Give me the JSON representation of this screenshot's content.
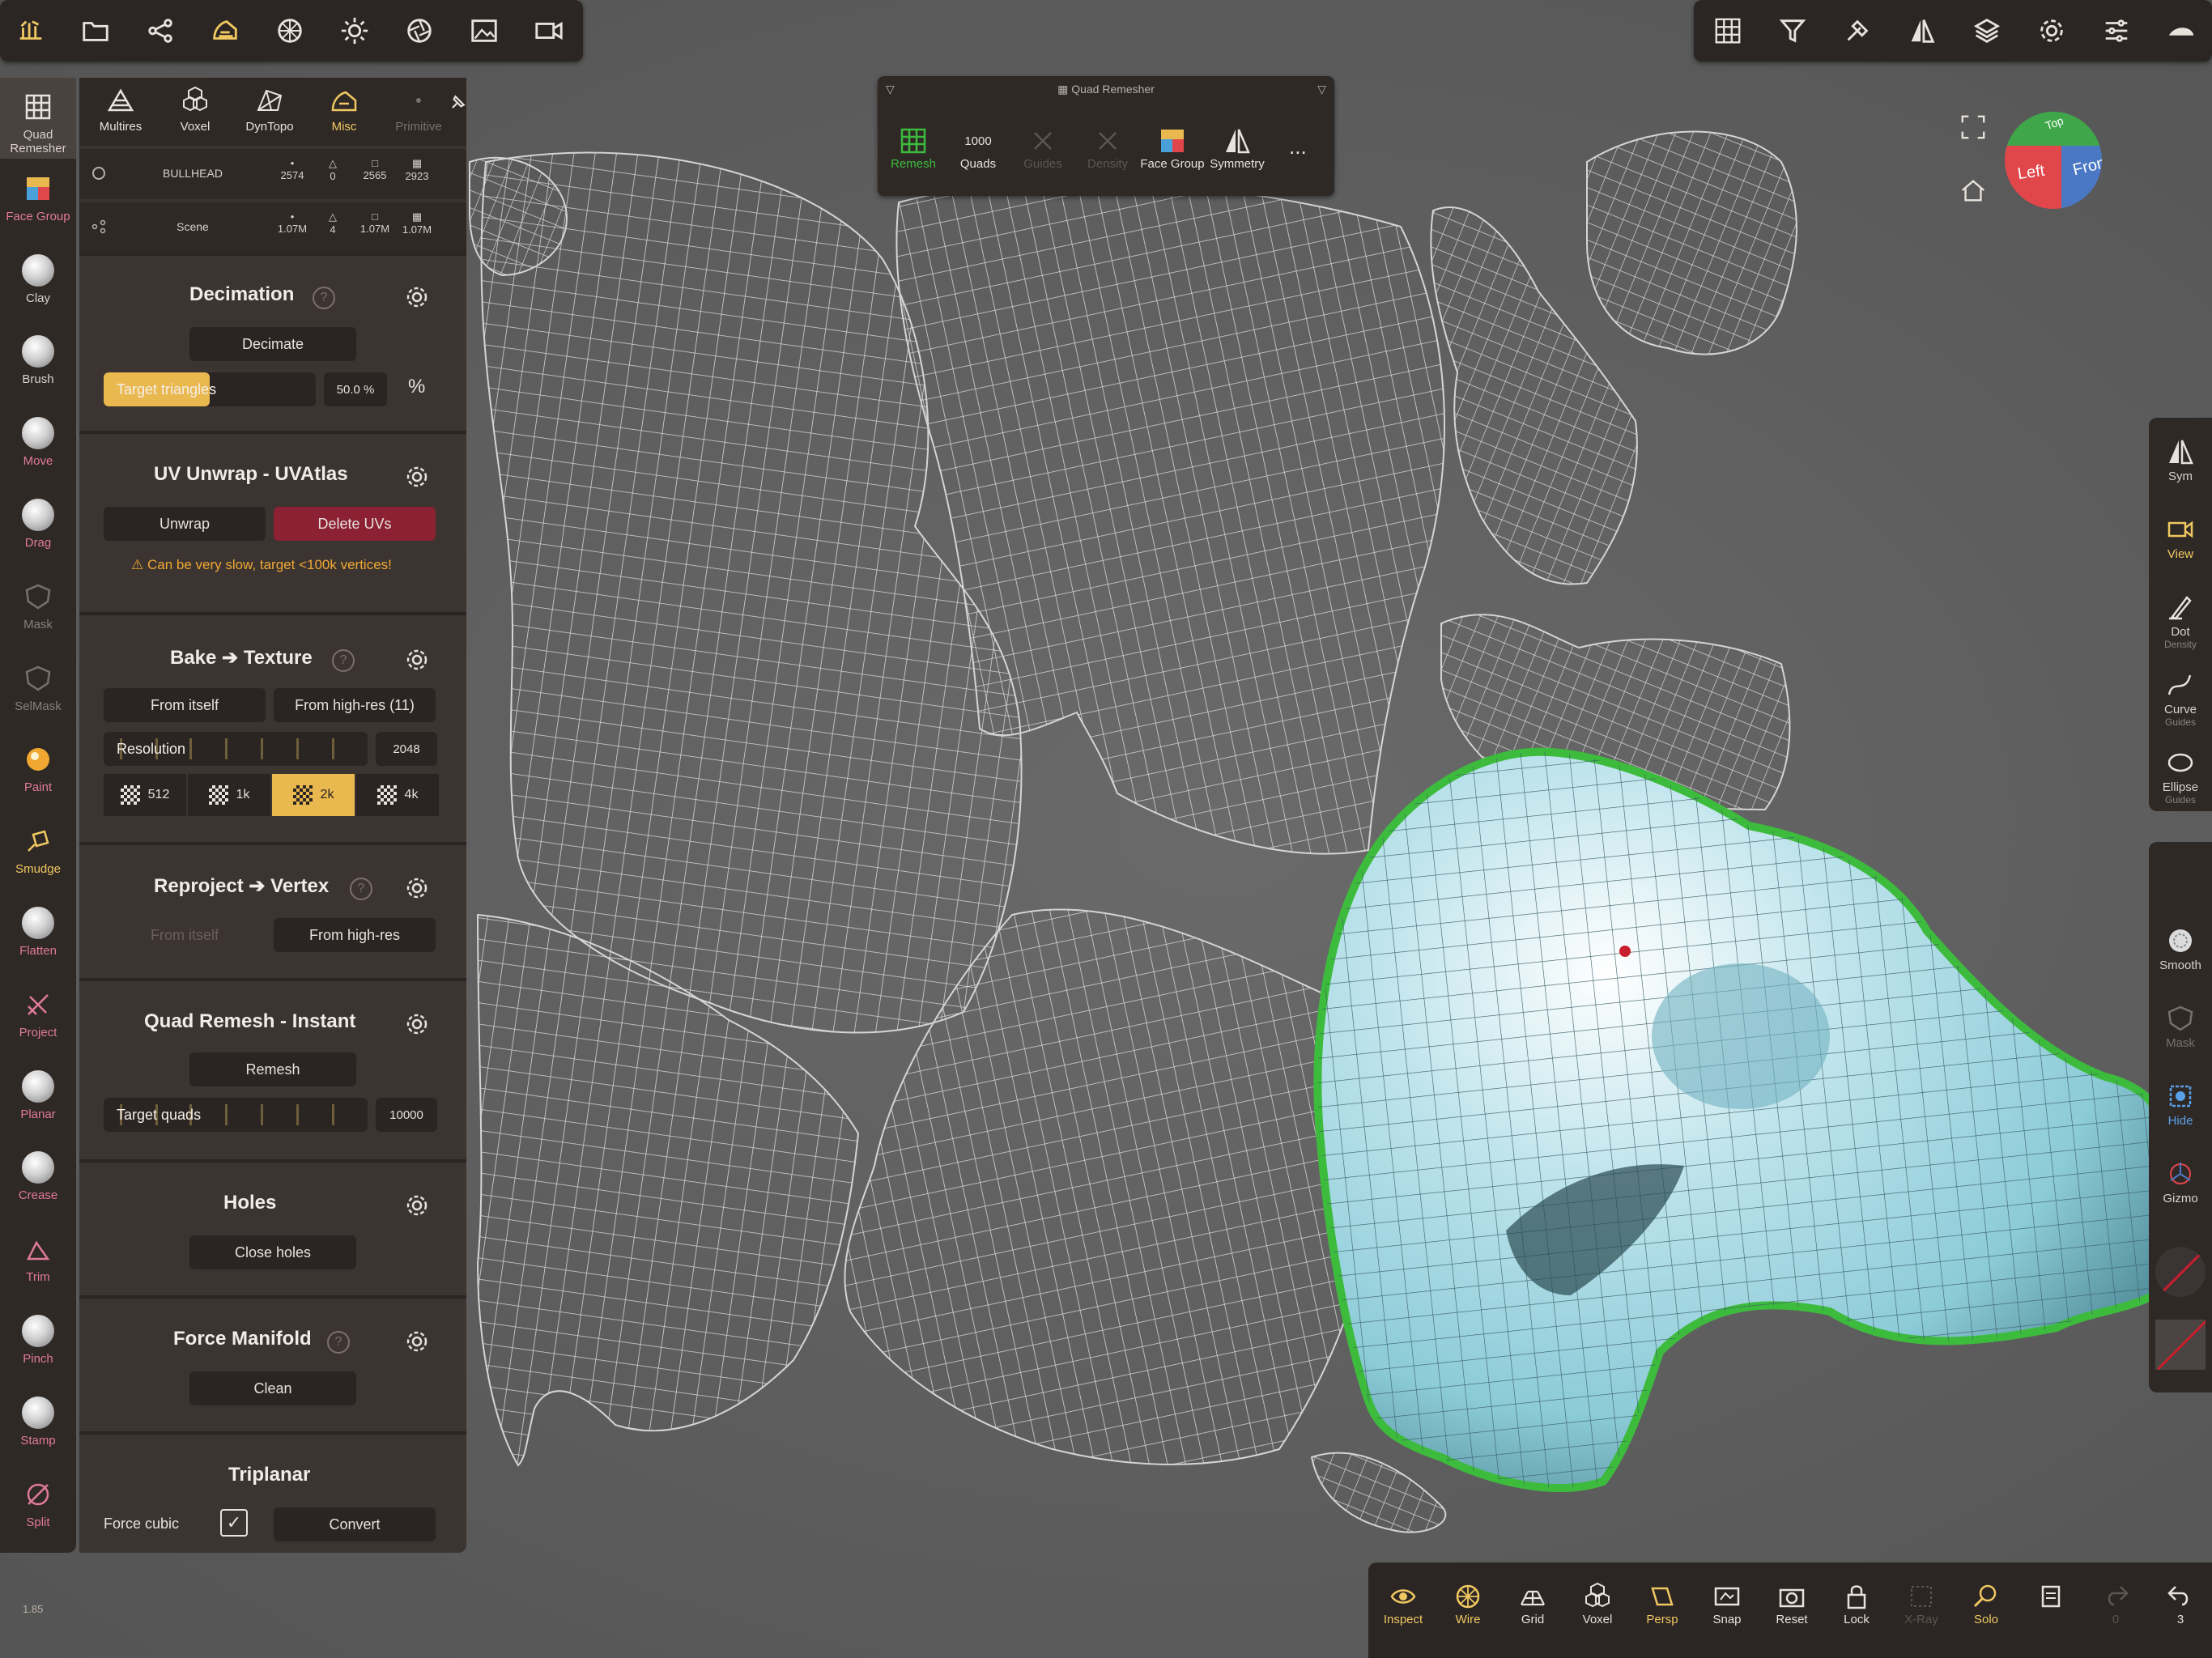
{
  "version": "1.85",
  "colors": {
    "accent": "#e9b84f",
    "danger": "#8b2133",
    "selection_outline": "#3dbb3d",
    "mesh": "#cfcfcf",
    "warning": "#f0a832"
  },
  "top_toolbar_left": {
    "icons": [
      "scene-icon",
      "folder-icon",
      "share-icon",
      "misc-icon",
      "material-icon",
      "light-icon",
      "camera-aperture-icon",
      "image-icon",
      "video-icon"
    ]
  },
  "top_toolbar_right": {
    "icons": [
      "grid-icon",
      "filter-icon",
      "tools-icon",
      "symmetry-icon",
      "layers-icon",
      "settings-icon",
      "sliders-icon",
      "nomad-logo-icon"
    ]
  },
  "left_tools": [
    {
      "label": "Quad Remesher",
      "icon": "quad-grid-icon",
      "style": "selected"
    },
    {
      "label": "Face Group",
      "icon": "face-group-icon",
      "style": "pink"
    },
    {
      "label": "Clay",
      "icon": "sphere-icon",
      "style": "normal"
    },
    {
      "label": "Brush",
      "icon": "sphere-icon",
      "style": "normal"
    },
    {
      "label": "Move",
      "icon": "sphere-icon",
      "style": "pink"
    },
    {
      "label": "Drag",
      "icon": "sphere-icon",
      "style": "pink"
    },
    {
      "label": "Mask",
      "icon": "mask-icon",
      "style": "dim"
    },
    {
      "label": "SelMask",
      "icon": "mask-icon",
      "style": "dim"
    },
    {
      "label": "Paint",
      "icon": "paint-icon",
      "style": "pink"
    },
    {
      "label": "Smudge",
      "icon": "smudge-icon",
      "style": "yellow"
    },
    {
      "label": "Flatten",
      "icon": "sphere-icon",
      "style": "pink"
    },
    {
      "label": "Project",
      "icon": "project-icon",
      "style": "pink"
    },
    {
      "label": "Planar",
      "icon": "sphere-icon",
      "style": "pink"
    },
    {
      "label": "Crease",
      "icon": "sphere-icon",
      "style": "pink"
    },
    {
      "label": "Trim",
      "icon": "trim-icon",
      "style": "pink"
    },
    {
      "label": "Pinch",
      "icon": "sphere-icon",
      "style": "pink"
    },
    {
      "label": "Stamp",
      "icon": "sphere-icon",
      "style": "pink"
    },
    {
      "label": "Split",
      "icon": "split-icon",
      "style": "pink"
    }
  ],
  "panel": {
    "tabs": [
      {
        "label": "Multires",
        "icon": "multires-icon",
        "state": "normal"
      },
      {
        "label": "Voxel",
        "icon": "voxel-icon",
        "state": "normal"
      },
      {
        "label": "DynTopo",
        "icon": "dyntopo-icon",
        "state": "normal"
      },
      {
        "label": "Misc",
        "icon": "misc-icon",
        "state": "active"
      },
      {
        "label": "Primitive",
        "icon": "primitive-icon",
        "state": "dim"
      }
    ],
    "object_info": {
      "name": "BULLHEAD",
      "vertices": "2574",
      "triangles": "0",
      "quads": "2565",
      "uvs": "2923"
    },
    "scene_info": {
      "name": "Scene",
      "vertices": "1.07M",
      "triangles": "4",
      "quads": "1.07M",
      "uvs": "1.07M"
    },
    "decimation": {
      "title": "Decimation",
      "button": "Decimate",
      "slider_label": "Target triangles",
      "slider_fraction": 0.5,
      "value": "50.0 %"
    },
    "uv_unwrap": {
      "title": "UV Unwrap - UVAtlas",
      "unwrap": "Unwrap",
      "delete": "Delete UVs",
      "warning": "Can be very slow, target <100k vertices!"
    },
    "bake": {
      "title": "Bake ➔ Texture",
      "from_itself": "From itself",
      "from_highres": "From high-res (11)",
      "resolution_label": "Resolution",
      "resolution_value": "2048",
      "options": [
        "512",
        "1k",
        "2k",
        "4k"
      ],
      "selected": "2k"
    },
    "reproject": {
      "title": "Reproject ➔ Vertex",
      "from_itself": "From itself",
      "from_highres": "From high-res"
    },
    "quad_remesh": {
      "title": "Quad Remesh - Instant",
      "button": "Remesh",
      "slider_label": "Target quads",
      "value": "10000"
    },
    "holes": {
      "title": "Holes",
      "button": "Close holes"
    },
    "force_manifold": {
      "title": "Force Manifold",
      "button": "Clean"
    },
    "triplanar": {
      "title": "Triplanar",
      "force_label": "Force cubic",
      "force_checked": true,
      "convert": "Convert"
    }
  },
  "quad_remesher": {
    "title": "Quad Remesher",
    "items": [
      {
        "label": "Remesh",
        "icon": "quad-grid-icon",
        "state": "green"
      },
      {
        "label": "Quads",
        "value": "1000",
        "state": "normal"
      },
      {
        "label": "Guides",
        "icon": "x-icon",
        "state": "dim"
      },
      {
        "label": "Density",
        "icon": "x-icon",
        "state": "dim"
      },
      {
        "label": "Face Group",
        "icon": "face-group-icon",
        "state": "normal"
      },
      {
        "label": "Symmetry",
        "icon": "symmetry-icon",
        "state": "normal"
      }
    ],
    "more": "..."
  },
  "nav_cube": {
    "left": "Left",
    "front": "Front",
    "top": "Top"
  },
  "right_tools_top": [
    {
      "label": "Sym",
      "sub": "",
      "icon": "symmetry-icon",
      "style": "normal"
    },
    {
      "label": "View",
      "sub": "",
      "icon": "camera-icon",
      "style": "yellow"
    },
    {
      "label": "Dot",
      "sub": "Density",
      "icon": "pen-icon",
      "style": "normal"
    },
    {
      "label": "Curve",
      "sub": "Guides",
      "icon": "curve-icon",
      "style": "normal"
    },
    {
      "label": "Ellipse",
      "sub": "Guides",
      "icon": "ellipse-icon",
      "style": "normal"
    }
  ],
  "right_tools_bottom": [
    {
      "label": "Smooth",
      "icon": "smooth-icon",
      "style": "normal"
    },
    {
      "label": "Mask",
      "icon": "mask-icon",
      "style": "dim"
    },
    {
      "label": "Hide",
      "icon": "hide-icon",
      "style": "blue"
    },
    {
      "label": "Gizmo",
      "icon": "gizmo-icon",
      "style": "normal"
    }
  ],
  "bottom_bar": [
    {
      "label": "Inspect",
      "icon": "eye-icon",
      "style": "yellow"
    },
    {
      "label": "Wire",
      "icon": "wire-icon",
      "style": "yellow"
    },
    {
      "label": "Grid",
      "icon": "grid-icon",
      "style": "normal"
    },
    {
      "label": "Voxel",
      "icon": "voxel-icon",
      "style": "normal"
    },
    {
      "label": "Persp",
      "icon": "persp-icon",
      "style": "yellow"
    },
    {
      "label": "Snap",
      "icon": "snap-icon",
      "style": "normal"
    },
    {
      "label": "Reset",
      "icon": "camera-reset-icon",
      "style": "normal"
    },
    {
      "label": "Lock",
      "icon": "lock-icon",
      "style": "normal"
    },
    {
      "label": "X-Ray",
      "icon": "xray-icon",
      "style": "dim"
    },
    {
      "label": "Solo",
      "icon": "search-icon",
      "style": "yellow"
    },
    {
      "label": "",
      "icon": "history-icon",
      "style": "normal"
    },
    {
      "label": "0",
      "icon": "redo-icon",
      "style": "dim"
    },
    {
      "label": "3",
      "icon": "undo-icon",
      "style": "normal"
    }
  ]
}
